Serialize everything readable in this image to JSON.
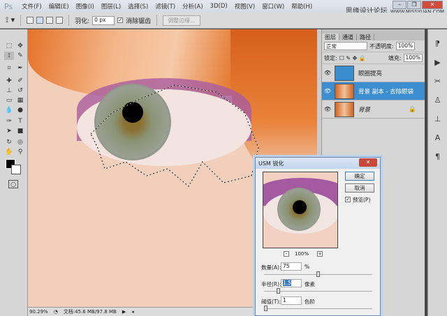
{
  "app": {
    "logo": "Ps"
  },
  "menu": [
    "文件(F)",
    "编辑(E)",
    "图像(I)",
    "图层(L)",
    "选择(S)",
    "滤镜(T)",
    "分析(A)",
    "3D(D)",
    "视图(V)",
    "窗口(W)",
    "帮助(H)"
  ],
  "watermark": {
    "cn": "思缘设计论坛",
    "url": "WWW.MISSYUAN.COM"
  },
  "window": {
    "minimize": "–",
    "restore": "❐",
    "close": "✕"
  },
  "options": {
    "feather_label": "羽化:",
    "feather_value": "0 px",
    "antialias_label": "消除锯齿",
    "antialias_checked": true,
    "refine_label": "调整边缘..."
  },
  "status": {
    "zoom": "90.29%",
    "doc": "文档:45.6 MB/97.8 MB"
  },
  "layers_panel": {
    "tabs": [
      "图层",
      "通道",
      "路径"
    ],
    "blend_mode": "正常",
    "opacity_label": "不透明度:",
    "opacity": "100%",
    "lock_label": "锁定:",
    "fill_label": "填充:",
    "fill": "100%",
    "layers": [
      {
        "name": "眼圈提亮",
        "selected": false,
        "thumb": "blue"
      },
      {
        "name": "背景 副本 - 去除眼袋",
        "selected": true,
        "thumb": "photo"
      },
      {
        "name": "背景",
        "selected": false,
        "thumb": "photo",
        "locked": true
      }
    ]
  },
  "dialog": {
    "title": "USM 锐化",
    "ok": "确定",
    "cancel": "取消",
    "preview_label": "预览(P)",
    "preview_checked": true,
    "zoom": "100%",
    "zoom_out": "-",
    "zoom_in": "+",
    "amount_label": "数量(A):",
    "amount": "75",
    "amount_unit": "%",
    "radius_label": "半径(R):",
    "radius": "1.5",
    "radius_unit": "像素",
    "threshold_label": "阈值(T):",
    "threshold": "1",
    "threshold_unit": "色阶",
    "amount_slider": 0.5,
    "radius_slider": 0.12,
    "threshold_slider": 0.0
  }
}
